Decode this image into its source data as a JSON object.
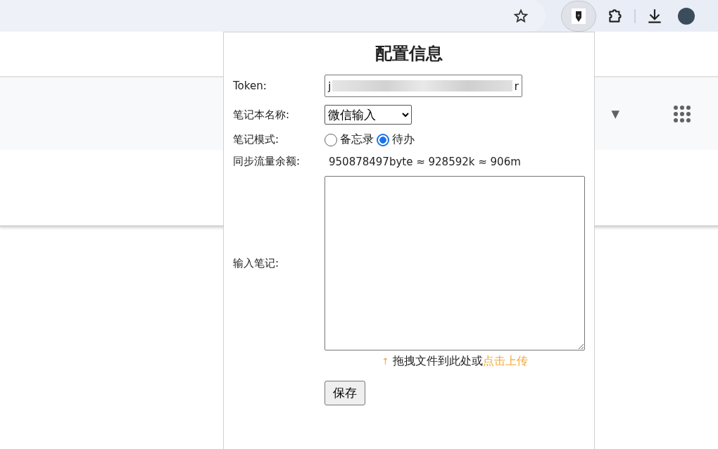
{
  "browser_toolbar": {
    "extension_active": true
  },
  "page_header": {
    "menu_caret": "▼"
  },
  "popup": {
    "title": "配置信息",
    "token": {
      "label": "Token:",
      "value_start": "j",
      "value_end": "r",
      "redacted": true
    },
    "notebook": {
      "label": "笔记本名称:",
      "value": "微信输入"
    },
    "mode": {
      "label": "笔记模式:",
      "options": [
        {
          "label": "备忘录",
          "selected": false
        },
        {
          "label": "待办",
          "selected": true
        }
      ]
    },
    "quota": {
      "label": "同步流量余额:",
      "value": "950878497byte ≈ 928592k ≈ 906m"
    },
    "note": {
      "label": "输入笔记:"
    },
    "upload_hint": {
      "arrow": "↑",
      "text": "拖拽文件到此处或",
      "link": "点击上传"
    },
    "save_button": "保存"
  }
}
